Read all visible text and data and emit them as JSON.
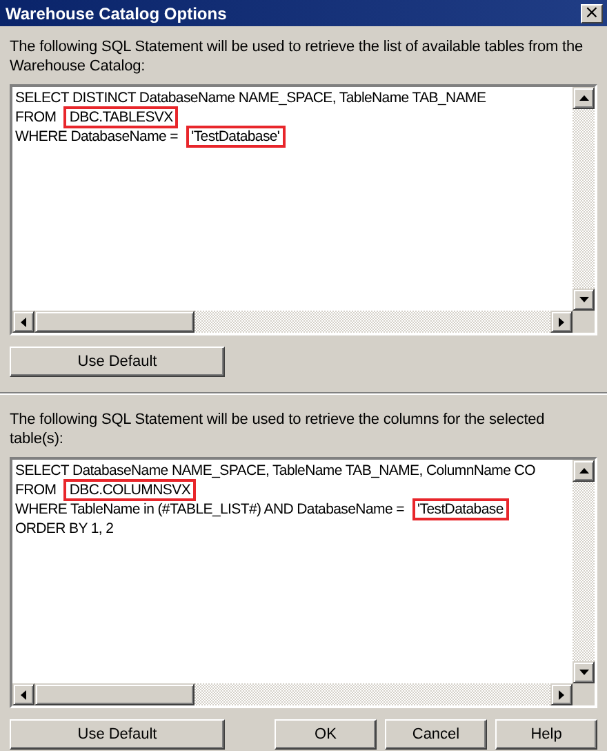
{
  "window": {
    "title": "Warehouse Catalog Options",
    "close_glyph": "×"
  },
  "sections": [
    {
      "description": "The following SQL Statement will be used to retrieve the list of available tables from the Warehouse Catalog:",
      "sql_lines": [
        [
          {
            "text": "SELECT DISTINCT DatabaseName NAME_SPACE, TableName TAB_NAME",
            "highlighted": false
          }
        ],
        [
          {
            "text": "FROM ",
            "highlighted": false
          },
          {
            "text": "DBC.TABLESVX",
            "highlighted": true
          }
        ],
        [
          {
            "text": "WHERE DatabaseName = ",
            "highlighted": false
          },
          {
            "text": "'TestDatabase'",
            "highlighted": true
          }
        ]
      ],
      "button": "Use Default"
    },
    {
      "description": "The following SQL Statement will be used to retrieve the columns for the selected table(s):",
      "sql_lines": [
        [
          {
            "text": "SELECT DatabaseName NAME_SPACE, TableName TAB_NAME, ColumnName CO",
            "highlighted": false
          }
        ],
        [
          {
            "text": "FROM ",
            "highlighted": false
          },
          {
            "text": "DBC.COLUMNSVX",
            "highlighted": true
          }
        ],
        [
          {
            "text": "WHERE TableName in (#TABLE_LIST#) AND DatabaseName = ",
            "highlighted": false
          },
          {
            "text": "'TestDatabase",
            "highlighted": true
          }
        ],
        [
          {
            "text": "ORDER BY 1, 2",
            "highlighted": false
          }
        ]
      ],
      "button": "Use Default"
    }
  ],
  "buttons": [
    "OK",
    "Cancel",
    "Help"
  ]
}
